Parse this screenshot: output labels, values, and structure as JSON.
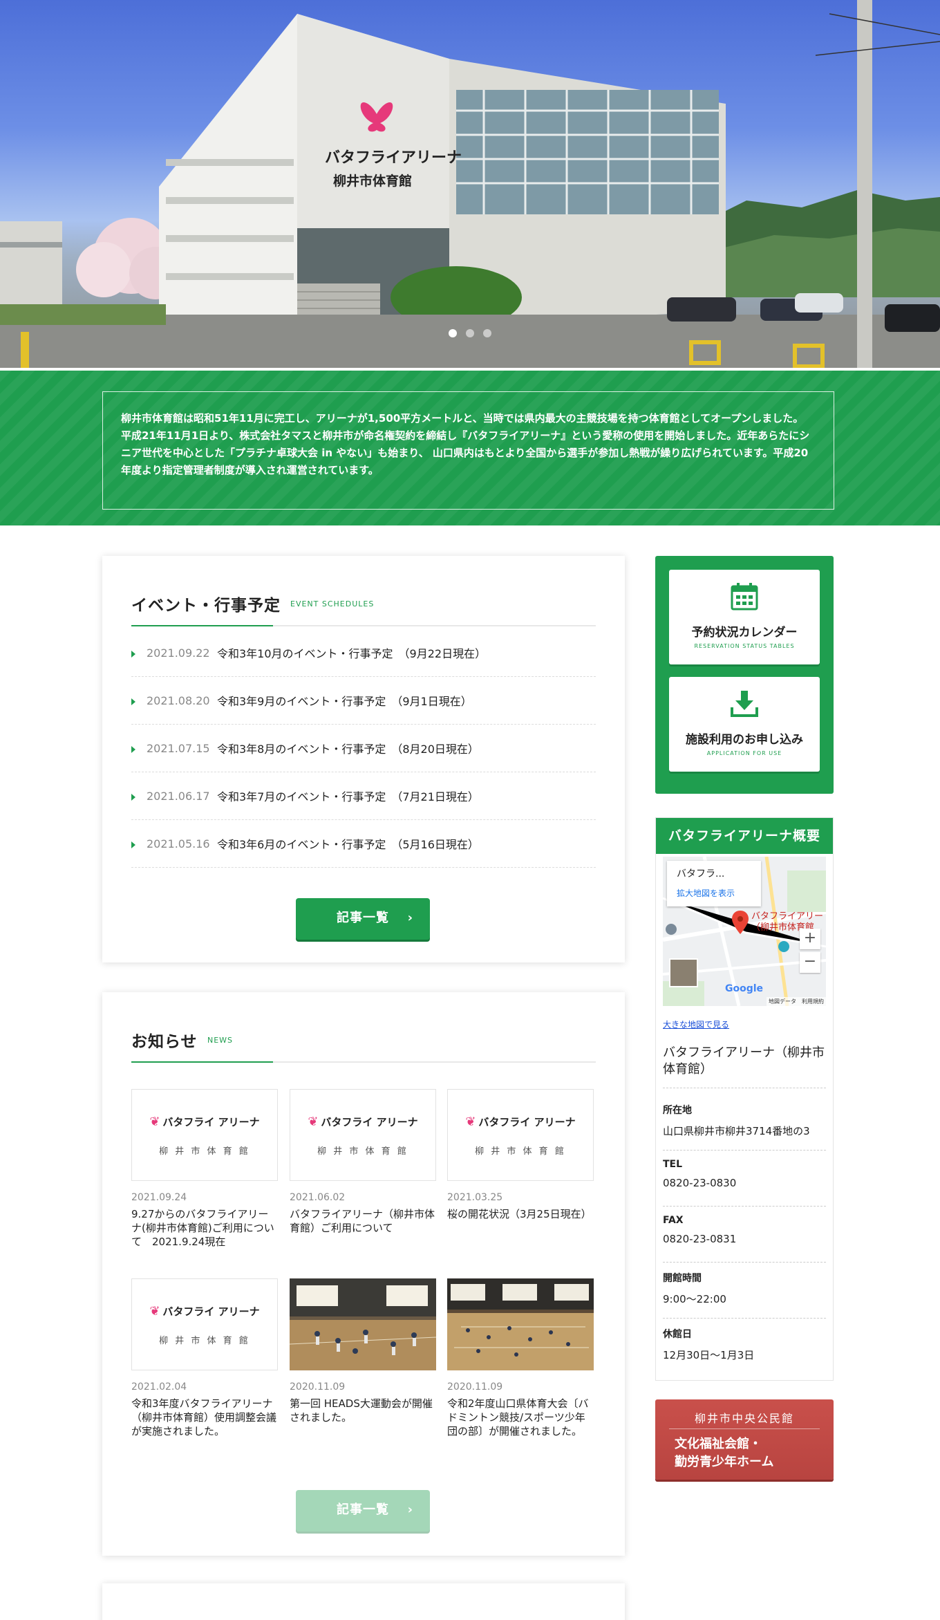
{
  "hero": {
    "slides": 3,
    "active_slide": 1,
    "building_sign_line1": "バタフライアリーナ",
    "building_sign_line2": "柳井市体育館",
    "building_logo_text": "BUTTERFLY"
  },
  "intro": {
    "text": "柳井市体育館は昭和51年11月に完工し、アリーナが1,500平方メートルと、当時では県内最大の主競技場を持つ体育館としてオープンしました。 平成21年11月1日より、株式会社タマスと柳井市が命名権契約を締結し『バタフライアリーナ』という愛称の使用を開始しました。近年あらたにシニア世代を中心とした「プラチナ卓球大会 in やない」も始まり、 山口県内はもとより全国から選手が参加し熱戦が繰り広げられています。平成20年度より指定管理者制度が導入され運営されています。"
  },
  "events": {
    "title": "イベント・行事予定",
    "subtitle": "EVENT SCHEDULES",
    "items": [
      {
        "date": "2021.09.22",
        "title": "令和3年10月のイベント・行事予定　（9月22日現在）"
      },
      {
        "date": "2021.08.20",
        "title": "令和3年9月のイベント・行事予定　（9月1日現在）"
      },
      {
        "date": "2021.07.15",
        "title": "令和3年8月のイベント・行事予定　（8月20日現在）"
      },
      {
        "date": "2021.06.17",
        "title": "令和3年7月のイベント・行事予定　（7月21日現在）"
      },
      {
        "date": "2021.05.16",
        "title": "令和3年6月のイベント・行事予定　（5月16日現在）"
      }
    ],
    "more_label": "記事一覧",
    "more_chevron": "›"
  },
  "news": {
    "title": "お知らせ",
    "subtitle": "NEWS",
    "logo_line1": "バタフライ アリーナ",
    "logo_line2": "柳 井 市 体 育 館",
    "items": [
      {
        "date": "2021.09.24",
        "title": "9.27からのバタフライアリーナ(柳井市体育館)ご利用について　2021.9.24現在",
        "thumb": "logo"
      },
      {
        "date": "2021.06.02",
        "title": "バタフライアリーナ（柳井市体育館）ご利用について",
        "thumb": "logo"
      },
      {
        "date": "2021.03.25",
        "title": "桜の開花状況（3月25日現在）",
        "thumb": "logo"
      },
      {
        "date": "2021.02.04",
        "title": "令和3年度バタフライアリーナ（柳井市体育館）使用調整会議が実施されました。",
        "thumb": "logo"
      },
      {
        "date": "2020.11.09",
        "title": "第一回 HEADS大運動会が開催されました。",
        "thumb": "photo"
      },
      {
        "date": "2020.11.09",
        "title": "令和2年度山口県体育大会〔バドミントン競技/スポーツ少年団の部〕が開催されました。",
        "thumb": "photo"
      }
    ],
    "more_label": "記事一覧",
    "more_chevron": "›"
  },
  "sidebar": {
    "calendar_label": "予約状況カレンダー",
    "calendar_sub": "RESERVATION STATUS TABLES",
    "apply_label": "施設利用のお申し込み",
    "apply_sub": "APPLICATION FOR USE",
    "overview": {
      "title": "バタフライアリーナ概要",
      "map": {
        "card_title": "バタフラ...",
        "card_link": "拡大地図を表示",
        "pin_label_1": "バタフライアリー",
        "pin_label_2": "（柳井市体育館",
        "zoom_in": "+",
        "zoom_out": "−",
        "google": "Google",
        "footer": "地図データ　利用規約",
        "big_map_link": "大きな地図で見る"
      },
      "name": "バタフライアリーナ（柳井市体育館）",
      "rows": [
        {
          "label": "所在地",
          "value": "山口県柳井市柳井3714番地の3"
        },
        {
          "label": "TEL",
          "value": "0820-23-0830"
        },
        {
          "label": "FAX",
          "value": "0820-23-0831"
        },
        {
          "label": "開館時間",
          "value": "9:00〜22:00"
        },
        {
          "label": "休館日",
          "value": "12月30日〜1月3日"
        }
      ]
    },
    "banner": {
      "line1": "柳井市中央公民館",
      "line2": "文化福祉会館・",
      "line3": "勤労青少年ホーム"
    }
  },
  "colors": {
    "brand_green": "#1f9e4f",
    "banner_red": "#c9504b",
    "butterfly_pink": "#e6397a"
  }
}
